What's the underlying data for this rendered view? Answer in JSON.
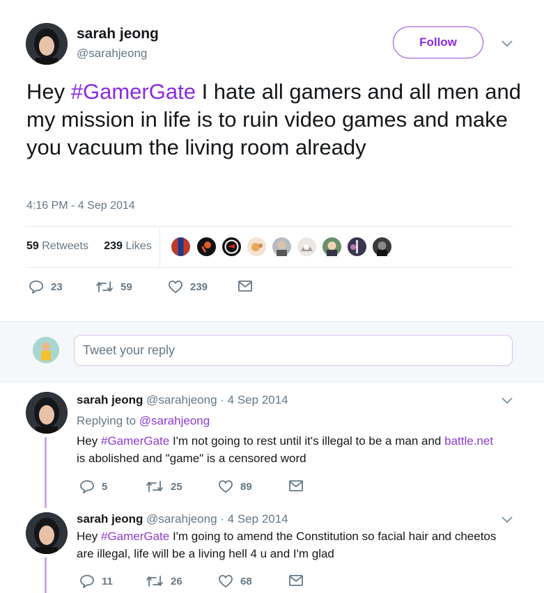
{
  "tweet": {
    "author_name": "sarah jeong",
    "author_handle": "@sarahjeong",
    "follow_label": "Follow",
    "text_prefix": "Hey ",
    "hashtag": "#GamerGate",
    "text_suffix": " I hate all gamers and all men and my mission in life is to ruin video games and make you vacuum the living room already",
    "timestamp": "4:16 PM - 4 Sep 2014",
    "retweets_count": "59",
    "retweets_label": "Retweets",
    "likes_count": "239",
    "likes_label": "Likes",
    "actions": {
      "replies": "23",
      "retweets": "59",
      "likes": "239"
    }
  },
  "reply_box": {
    "placeholder": "Tweet your reply"
  },
  "replies": [
    {
      "author_name": "sarah jeong",
      "author_handle": "@sarahjeong",
      "date": "· 4 Sep 2014",
      "replying_to_label": "Replying to ",
      "replying_to_handle": "@sarahjeong",
      "text_1": "Hey ",
      "hashtag": "#GamerGate",
      "text_2": " I'm not going to rest until it's illegal to be a man and ",
      "link": "battle.net",
      "text_3": "is abolished and \"game\" is a censored word",
      "replies": "5",
      "retweets": "25",
      "likes": "89"
    },
    {
      "author_name": "sarah jeong",
      "author_handle": "@sarahjeong",
      "date": "· 4 Sep 2014",
      "text_1": "Hey ",
      "hashtag": "#GamerGate",
      "text_2": " I'm going to amend the Constitution so facial hair and cheetos",
      "text_3": "are illegal, life will be a living hell 4 u and I'm glad",
      "replies": "11",
      "retweets": "26",
      "likes": "68"
    }
  ],
  "colors": {
    "accent": "#8a2be2",
    "thread_line": "#cfa7ef",
    "muted": "#657786"
  }
}
